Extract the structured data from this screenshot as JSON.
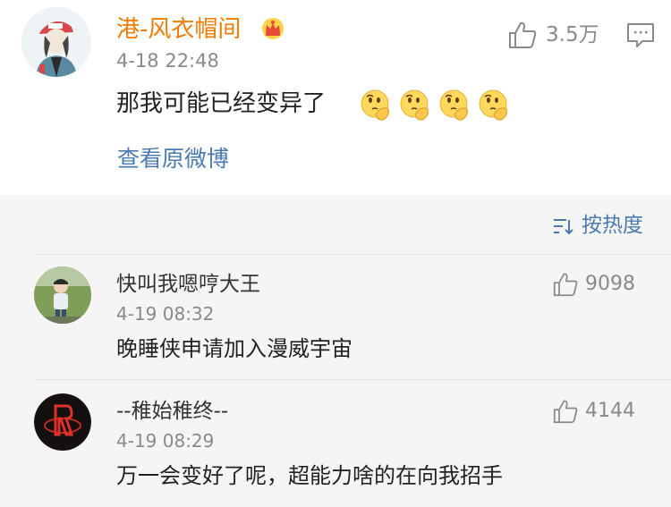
{
  "main_comment": {
    "username": "港-风衣帽间",
    "badge_icon": "crown-icon",
    "time": "4-18 22:48",
    "like_count": "3.5万",
    "text": "那我可能已经变异了",
    "emoji_count": 4,
    "view_original": "查看原微博"
  },
  "replies": {
    "sort_label": "按热度",
    "items": [
      {
        "username": "快叫我嗯哼大王",
        "time": "4-19 08:32",
        "like_count": "9098",
        "text": "晚睡侠申请加入漫威宇宙"
      },
      {
        "username": "--稚始稚终--",
        "time": "4-19 08:29",
        "like_count": "4144",
        "text": "万一会变好了呢，超能力啥的在向我招手"
      }
    ]
  },
  "colors": {
    "username": "#f07b00",
    "link": "#4a7ab0",
    "meta": "#8a8a8a",
    "panel_bg": "#f5f5f5"
  }
}
